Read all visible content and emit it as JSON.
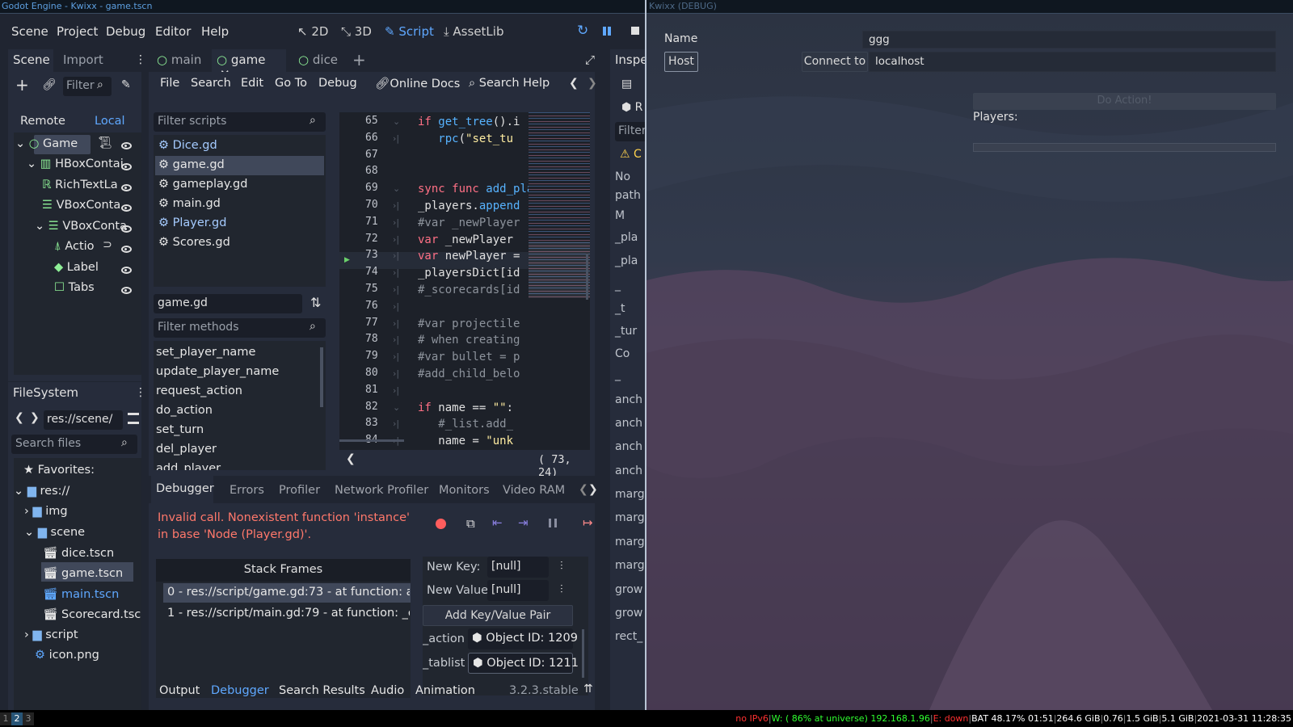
{
  "window_titles": {
    "godot": "Godot Engine - Kwixx - game.tscn",
    "game": "Kwixx (DEBUG)"
  },
  "menu": [
    "Scene",
    "Project",
    "Debug",
    "Editor",
    "Help"
  ],
  "workspaces": [
    "2D",
    "3D",
    "Script",
    "AssetLib"
  ],
  "scene_dock": {
    "tabs": [
      "Scene",
      "Import"
    ],
    "filter_placeholder": "Filter",
    "remote": "Remote",
    "local": "Local",
    "tree": [
      "Game",
      "HBoxContai",
      "RichTextLa",
      "VBoxConta",
      "VBoxConta",
      "Actio",
      "Label",
      "Tabs"
    ]
  },
  "filesystem": {
    "tab": "FileSystem",
    "path": "res://scene/",
    "search_placeholder": "Search files",
    "tree": [
      "Favorites:",
      "res://",
      "img",
      "scene",
      "dice.tscn",
      "game.tscn",
      "main.tscn",
      "Scorecard.tsc",
      "script",
      "icon.png"
    ]
  },
  "scene_tabs": [
    "main",
    "game",
    "dice"
  ],
  "script_menu": [
    "File",
    "Search",
    "Edit",
    "Go To",
    "Debug",
    "Online Docs",
    "Search Help"
  ],
  "scripts": {
    "filter_placeholder": "Filter scripts",
    "items": [
      "Dice.gd",
      "game.gd",
      "gameplay.gd",
      "main.gd",
      "Player.gd",
      "Scores.gd"
    ],
    "current": "game.gd"
  },
  "methods": {
    "filter_placeholder": "Filter methods",
    "items": [
      "set_player_name",
      "update_player_name",
      "request_action",
      "do_action",
      "set_turn",
      "del_player",
      "add_player"
    ]
  },
  "code": {
    "lines": [
      "65",
      "66",
      "67",
      "68",
      "69",
      "70",
      "71",
      "72",
      "73",
      "74",
      "75",
      "76",
      "77",
      "78",
      "79",
      "80",
      "81",
      "82",
      "83",
      "84"
    ],
    "cursor": "( 73, 24)"
  },
  "debugger": {
    "tabs": [
      "Debugger",
      "Errors",
      "Profiler",
      "Network Profiler",
      "Monitors",
      "Video RAM"
    ],
    "error": "Invalid call. Nonexistent function 'instance' in base 'Node (Player.gd)'.",
    "stack_header": "Stack Frames",
    "frames": [
      "0 - res://script/game.gd:73 - at function: add_",
      "1 - res://script/main.gd:79 - at function: _on_"
    ],
    "new_key_label": "New Key:",
    "new_key": "[null]",
    "new_value_label": "New Value",
    "new_value": "[null]",
    "add_pair": "Add Key/Value Pair",
    "vars": [
      {
        "name": "_action",
        "value": "Object ID: 1209"
      },
      {
        "name": "_tablist",
        "value": "Object ID: 1211"
      }
    ]
  },
  "bottom_tabs": [
    "Output",
    "Debugger",
    "Search Results",
    "Audio",
    "Animation"
  ],
  "version": "3.2.3.stable",
  "inspector": {
    "title": "Inspe",
    "filter": "Filter",
    "rows": [
      "No",
      "path",
      "M",
      "_pla",
      "_pla",
      "_",
      "_t",
      "_tur",
      "Co",
      "_",
      "anch",
      "anch",
      "anch",
      "anch",
      "marg",
      "marg",
      "marg",
      "marg",
      "grow",
      "grow",
      "rect_"
    ]
  },
  "game": {
    "name_label": "Name",
    "name_value": "ggg",
    "host": "Host",
    "connect": "Connect to",
    "address": "localhost",
    "do_action": "Do Action!",
    "players": "Players:"
  },
  "status": {
    "workspaces": [
      "1",
      "2",
      "3"
    ],
    "ipv6": "no IPv6",
    "wifi": "W: ( 86% at universe) 192.168.1.96",
    "eth": "E: down",
    "bat": "BAT 48.17% 01:51",
    "disk": "264.6 GiB",
    "load": "0.76",
    "mem1": "1.5 GiB",
    "mem2": "5.1 GiB",
    "time": "2021-03-31 11:28:35"
  }
}
